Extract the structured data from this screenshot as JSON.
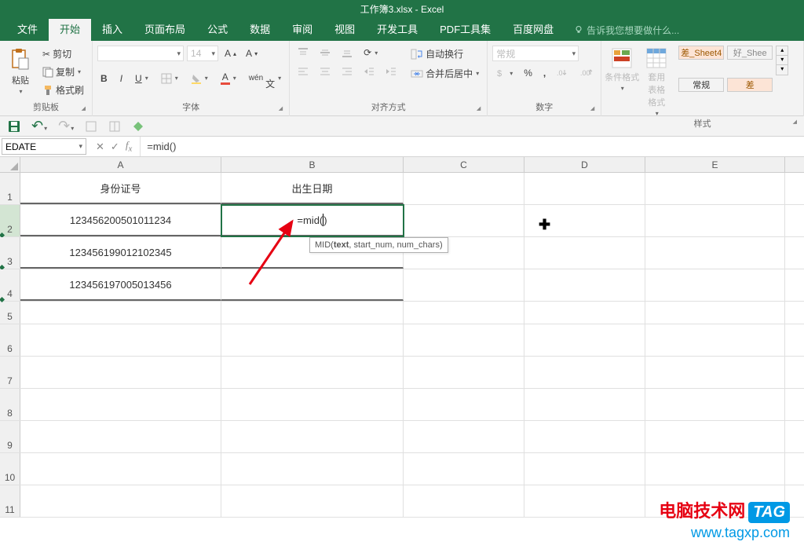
{
  "title": "工作簿3.xlsx - Excel",
  "tabs": [
    "文件",
    "开始",
    "插入",
    "页面布局",
    "公式",
    "数据",
    "审阅",
    "视图",
    "开发工具",
    "PDF工具集",
    "百度网盘"
  ],
  "active_tab": 1,
  "tell_me": "告诉我您想要做什么...",
  "clipboard": {
    "cut": "剪切",
    "copy": "复制",
    "paint": "格式刷",
    "paste": "粘贴",
    "label": "剪贴板"
  },
  "font": {
    "size": "14",
    "label": "字体"
  },
  "align": {
    "wrap": "自动换行",
    "merge": "合并后居中",
    "label": "对齐方式"
  },
  "number": {
    "format": "常规",
    "label": "数字"
  },
  "styles": {
    "cond": "条件格式",
    "table": "套用\n表格格式",
    "s1": "差_Sheet4",
    "s2": "好_Shee",
    "s3": "常规",
    "s4": "差",
    "label": "样式"
  },
  "name_box": "EDATE",
  "formula": "=mid()",
  "tooltip": {
    "func": "MID",
    "arg1": "text",
    "rest": ", start_num, num_chars)"
  },
  "headers": {
    "A": "身份证号",
    "B": "出生日期"
  },
  "data": {
    "A2": "123456200501011234",
    "A3": "123456199012102345",
    "A4": "123456197005013456",
    "B2": "=mid("
  },
  "cols": [
    "A",
    "B",
    "C",
    "D",
    "E"
  ],
  "watermark": {
    "line1": "电脑技术网",
    "tag": "TAG",
    "line2": "www.tagxp.com"
  }
}
